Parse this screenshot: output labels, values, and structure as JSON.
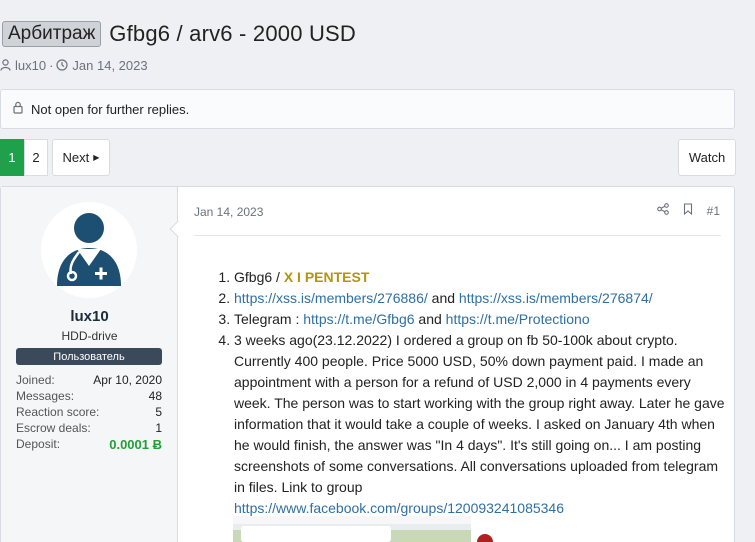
{
  "thread": {
    "prefix": "Арбитраж",
    "title": "Gfbg6 / arv6 - 2000 USD",
    "author": "lux10",
    "date": "Jan 14, 2023",
    "meta_separator": "·"
  },
  "notice": {
    "text": "Not open for further replies."
  },
  "pagination": {
    "pages": [
      "1",
      "2"
    ],
    "current": "1",
    "next_label": "Next"
  },
  "watch_label": "Watch",
  "user": {
    "name": "lux10",
    "title": "HDD-drive",
    "banner": "Пользователь",
    "stats": [
      {
        "label": "Joined:",
        "value": "Apr 10, 2020"
      },
      {
        "label": "Messages:",
        "value": "48"
      },
      {
        "label": "Reaction score:",
        "value": "5"
      },
      {
        "label": "Escrow deals:",
        "value": "1"
      },
      {
        "label": "Deposit:",
        "value": "0.0001 Ƀ"
      }
    ]
  },
  "post": {
    "date": "Jan 14, 2023",
    "number": "#1",
    "items": {
      "i1_text": "Gfbg6 / ",
      "i1_gold": "X I PENTEST",
      "i2_link1": "https://xss.is/members/276886/",
      "i2_and": " and ",
      "i2_link2": "https://xss.is/members/276874/",
      "i3_text": "Telegram : ",
      "i3_link1": "https://t.me/Gfbg6",
      "i3_and": " and ",
      "i3_link2": "https://t.me/Protectiono",
      "i4_text": "3 weeks ago(23.12.2022) I ordered a group on fb 50-100k about crypto. Currently 400 people. Price 5000 USD, 50% down payment paid. I made an appointment with a person for a refund of USD 2,000 in 4 payments every week. The person was to start working with the group right away. Later he gave information that it would take a couple of weeks. I asked on January 4th when he would finish, the answer was \"In 4 days\". It's still going on... I am posting screenshots of some conversations. All conversations uploaded from telegram in files. Link to group",
      "i4_link": "https://www.facebook.com/groups/120093241085346"
    }
  },
  "colors": {
    "accent_green": "#1fa04b",
    "link": "#2f6fa3",
    "gold": "#b3950d",
    "avatar": "#1c4f72"
  }
}
